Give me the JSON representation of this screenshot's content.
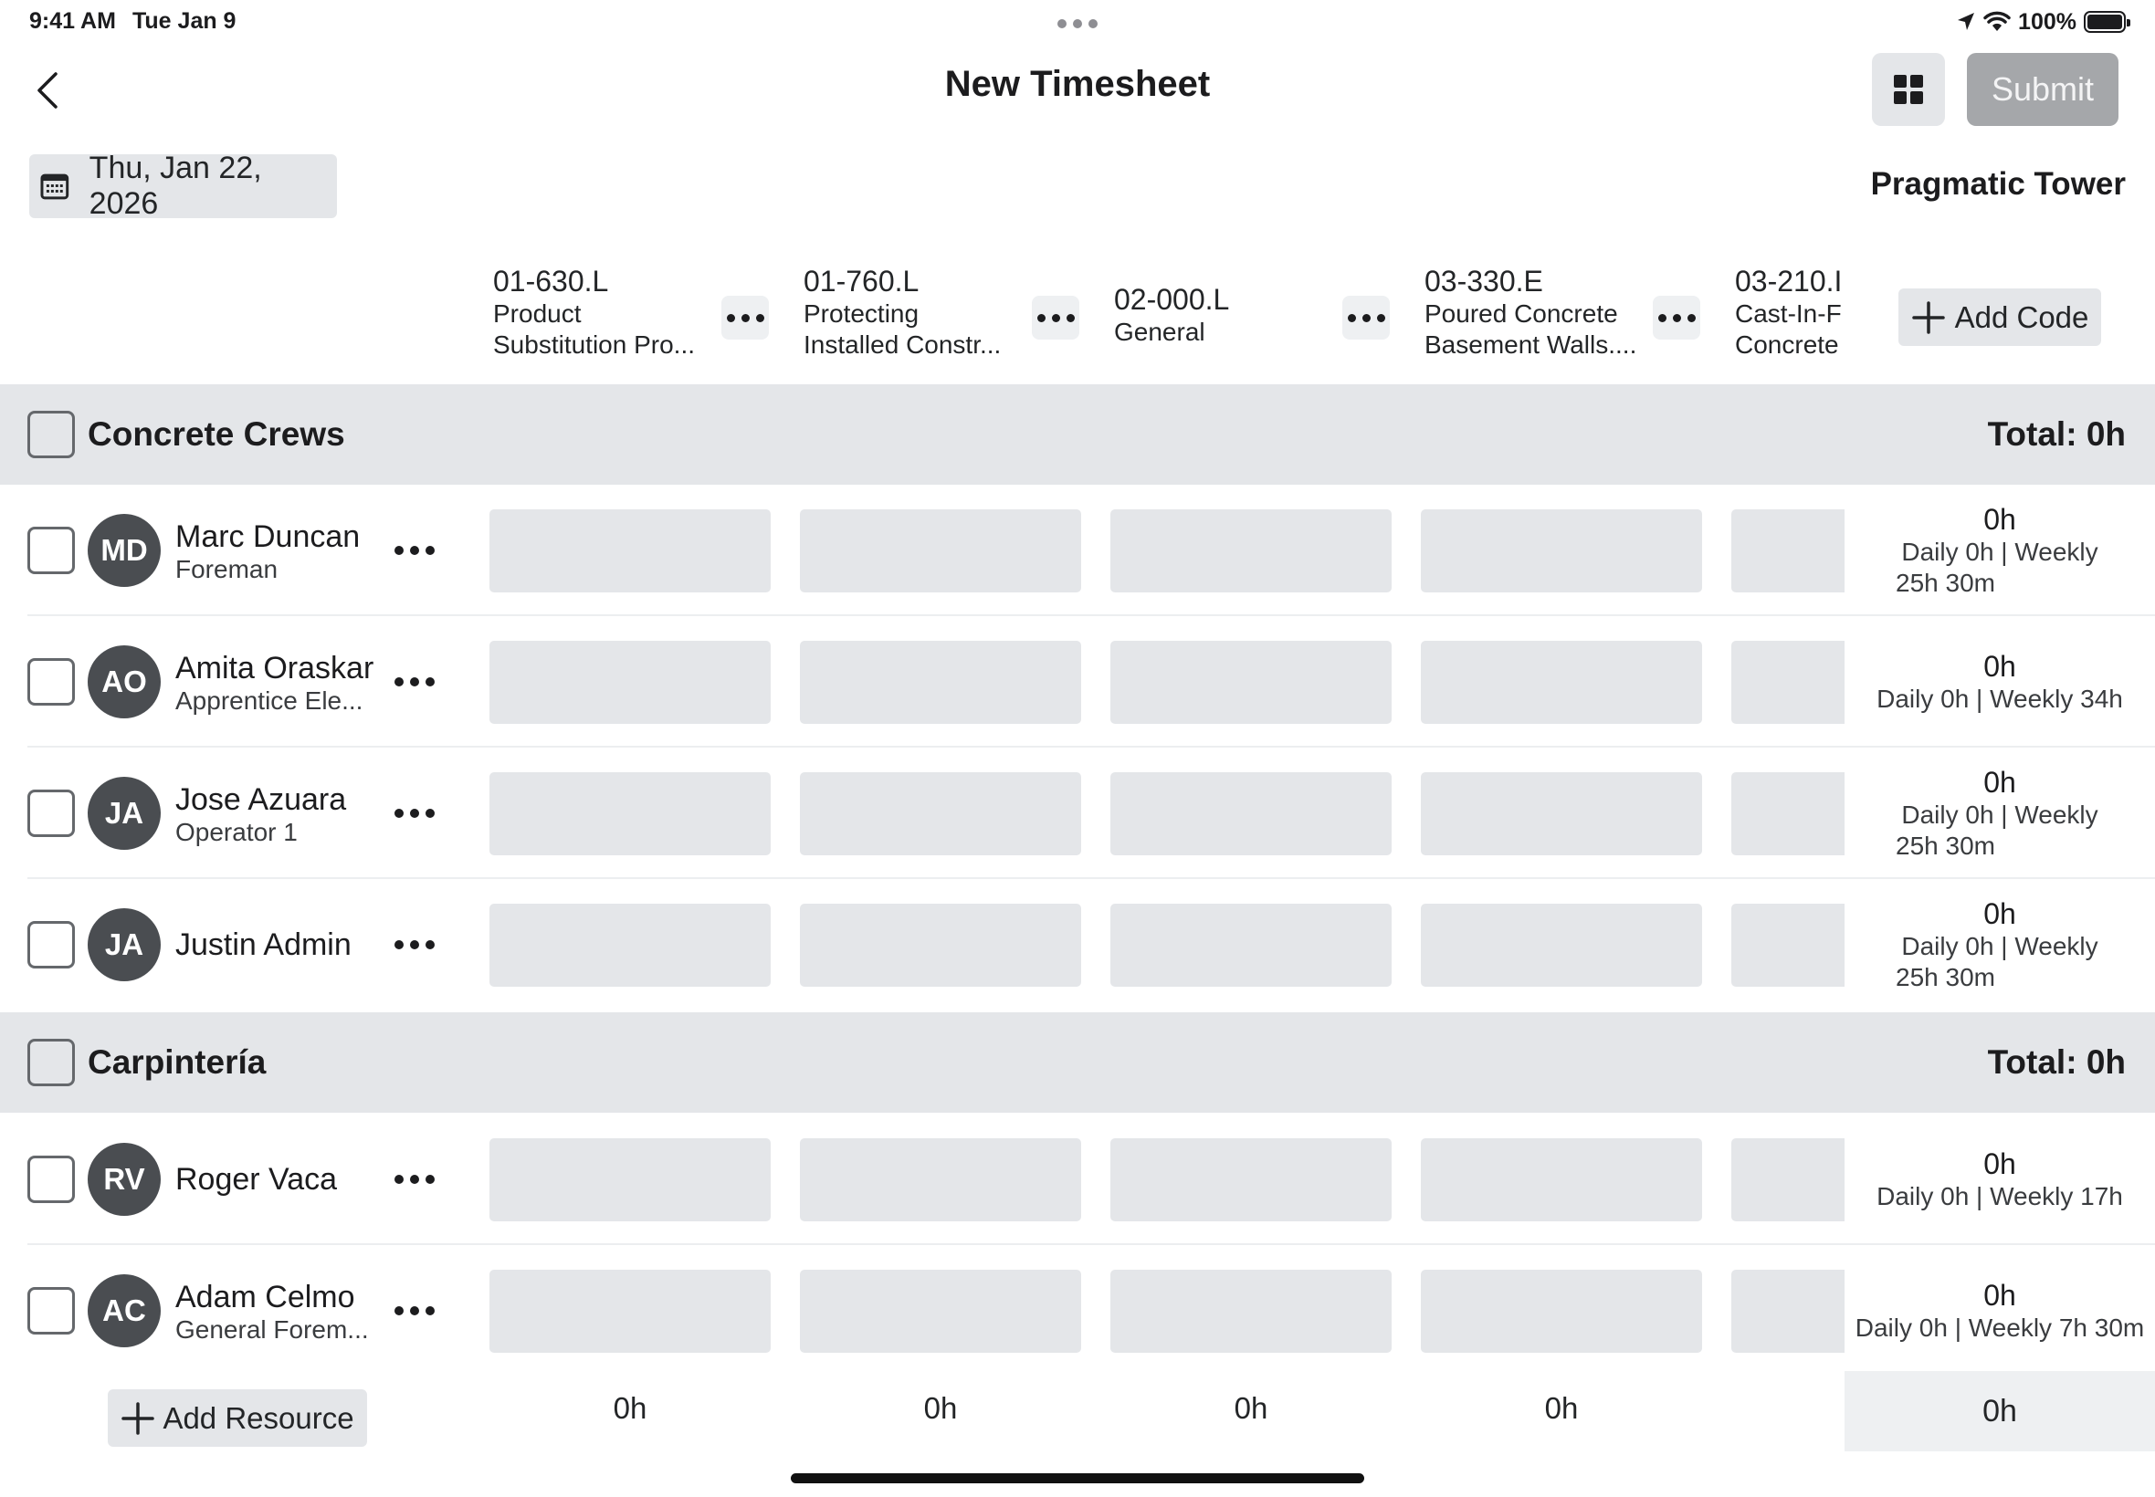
{
  "status_bar": {
    "time": "9:41 AM",
    "date": "Tue Jan 9",
    "battery": "100%",
    "icons": [
      "location-arrow-icon",
      "wifi-icon",
      "battery-icon"
    ]
  },
  "nav": {
    "title": "New Timesheet",
    "submit_label": "Submit",
    "back_icon": "chevron-left-icon",
    "view_icon": "grid-view-icon"
  },
  "date_picker": {
    "label": "Thu, Jan 22, 2026",
    "icon": "calendar-icon"
  },
  "project": {
    "name": "Pragmatic Tower"
  },
  "codes": [
    {
      "code": "01-630.L",
      "desc1": "Product",
      "desc2": "Substitution Pro..."
    },
    {
      "code": "01-760.L",
      "desc1": "Protecting",
      "desc2": "Installed Constr..."
    },
    {
      "code": "02-000.L",
      "desc1": "General",
      "desc2": ""
    },
    {
      "code": "03-330.E",
      "desc1": "Poured Concrete",
      "desc2": "Basement Walls...."
    },
    {
      "code": "03-210.I",
      "desc1": "Cast-In-F",
      "desc2": "Concrete"
    }
  ],
  "add_code_label": "Add Code",
  "groups": [
    {
      "name": "Concrete Crews",
      "total": "Total: 0h",
      "resources": [
        {
          "initials": "MD",
          "name": "Marc Duncan",
          "role": "Foreman",
          "total": "0h",
          "detail1": "Daily 0h | Weekly",
          "detail2": "25h 30m"
        },
        {
          "initials": "AO",
          "name": "Amita Oraskar",
          "role": "Apprentice Ele...",
          "total": "0h",
          "detail1": "Daily 0h | Weekly 34h",
          "detail2": ""
        },
        {
          "initials": "JA",
          "name": "Jose Azuara",
          "role": "Operator 1",
          "total": "0h",
          "detail1": "Daily 0h | Weekly",
          "detail2": "25h 30m"
        },
        {
          "initials": "JA",
          "name": "Justin Admin",
          "role": "",
          "total": "0h",
          "detail1": "Daily 0h | Weekly",
          "detail2": "25h 30m"
        }
      ]
    },
    {
      "name": "Carpintería",
      "total": "Total: 0h",
      "resources": [
        {
          "initials": "RV",
          "name": "Roger Vaca",
          "role": "",
          "total": "0h",
          "detail1": "Daily 0h | Weekly 17h",
          "detail2": ""
        },
        {
          "initials": "AC",
          "name": "Adam Celmo",
          "role": "General Forem...",
          "total": "0h",
          "detail1": "Daily 0h | Weekly 7h 30m",
          "detail2": ""
        }
      ]
    }
  ],
  "footer": {
    "add_resource_label": "Add Resource",
    "column_totals": [
      "0h",
      "0h",
      "0h",
      "0h"
    ],
    "grand_total": "0h"
  },
  "colors": {
    "surface_gray": "#e4e6e9",
    "avatar_bg": "#4a4d51",
    "submit_disabled": "#a5a7aa",
    "text": "#1c1c1e"
  }
}
